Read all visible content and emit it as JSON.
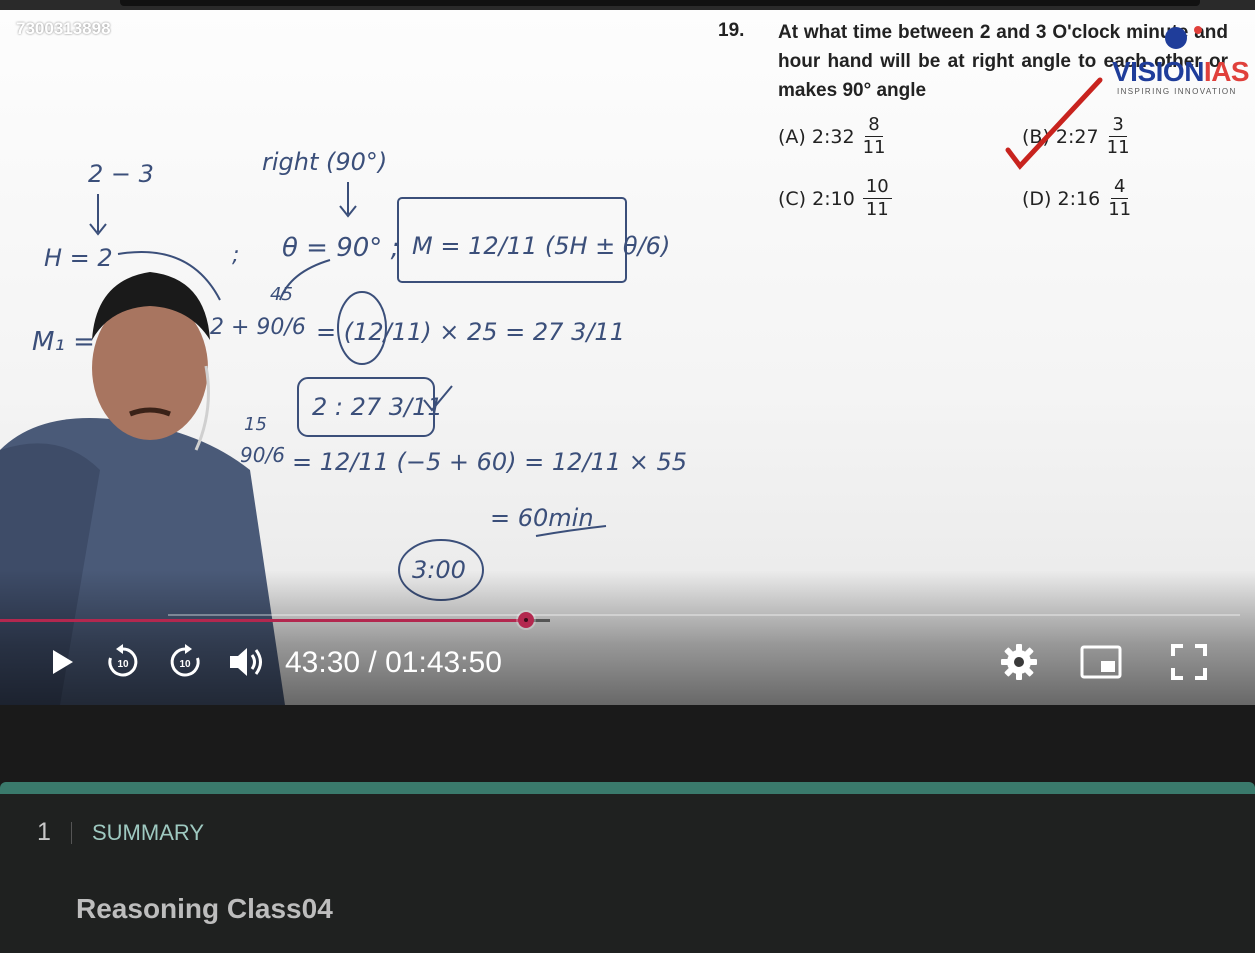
{
  "video": {
    "watermark_id": "7300313898",
    "question": {
      "number": "19.",
      "text": "At what time between 2 and 3 O'clock minute and hour hand will be at right angle to each other or makes 90° angle",
      "options": [
        {
          "label": "(A) 2:32",
          "numerator": "8",
          "denominator": "11"
        },
        {
          "label": "(B) 2:27",
          "numerator": "3",
          "denominator": "11"
        },
        {
          "label": "(C) 2:10",
          "numerator": "10",
          "denominator": "11"
        },
        {
          "label": "(D) 2:16",
          "numerator": "4",
          "denominator": "11"
        }
      ]
    },
    "logo": {
      "main": "VISION",
      "accent": "IAS",
      "tagline": "INSPIRING INNOVATION"
    },
    "board": {
      "l1": "2 − 3",
      "l2": "right (90°)",
      "l3": "H = 2",
      "l4": "θ = 90° ;",
      "l5": "M = 12/11 (5H ± θ/6)",
      "l6": "M₁ =",
      "l7": "2 + 90/6",
      "l8": "45",
      "l9": "= (12/11) × 25 = 27 3/11",
      "l10": "2 : 27 3/11",
      "l11": "15",
      "l12": "90/6",
      "l13": "= 12/11 (−5 + 60) = 12/11 × 55",
      "l14": "= 60min",
      "l15": "3:00"
    }
  },
  "player": {
    "progress": 0.4193,
    "current_time": "43:30",
    "separator": "/",
    "duration": "01:43:50",
    "skip_seconds": "10",
    "colors": {
      "played": "#b3284f",
      "accent_line": "#3a7a6c"
    }
  },
  "icons": {
    "play": "play-icon",
    "rewind": "rewind-10-icon",
    "forward": "forward-10-icon",
    "volume": "volume-icon",
    "settings": "gear-icon",
    "pip": "picture-in-picture-icon",
    "fullscreen": "fullscreen-icon"
  },
  "chapters": {
    "number": "1",
    "tab_label": "SUMMARY"
  },
  "lesson_title": "Reasoning Class04"
}
